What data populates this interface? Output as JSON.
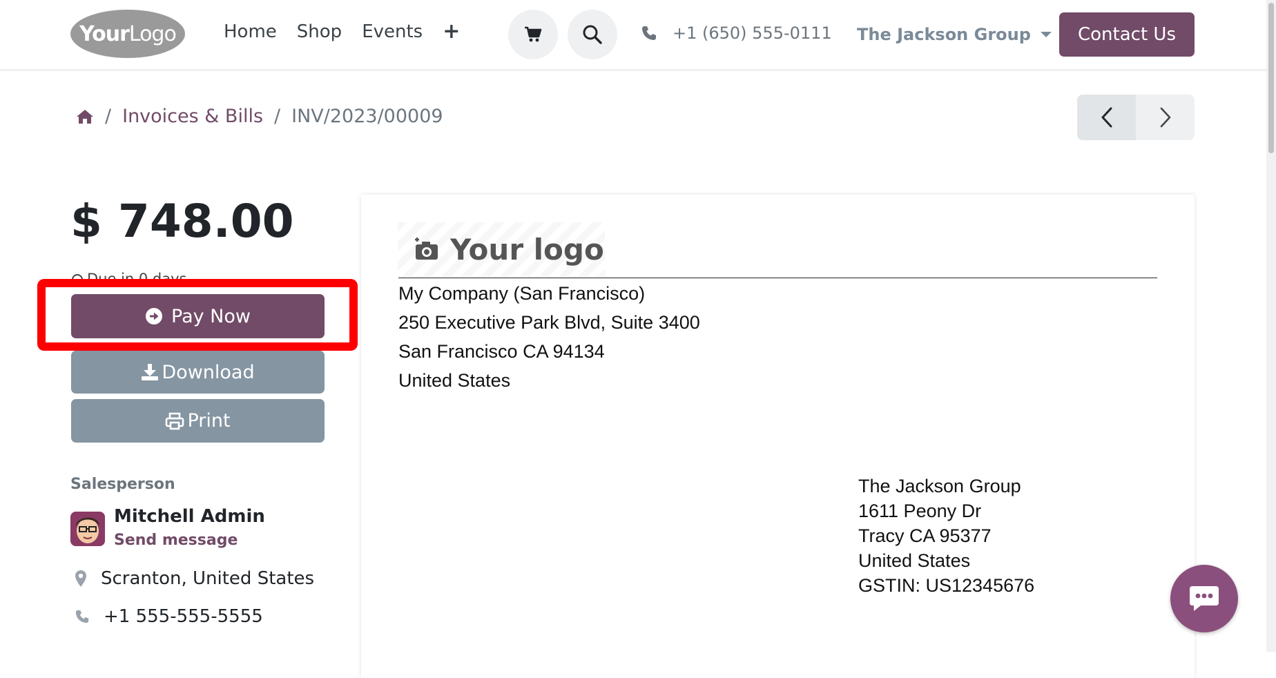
{
  "header": {
    "logo": {
      "bold": "Your",
      "light": "Logo"
    },
    "nav": [
      "Home",
      "Shop",
      "Events"
    ],
    "nav_more": "+",
    "phone": "+1 (650) 555-0111",
    "account": "The Jackson Group",
    "contact_label": "Contact Us"
  },
  "breadcrumb": {
    "sep": "/",
    "section": "Invoices & Bills",
    "current": "INV/2023/00009"
  },
  "summary": {
    "amount": "$ 748.00",
    "due_text": "Due in 0 days",
    "pay_label": "Pay Now",
    "download_label": "Download",
    "print_label": "Print"
  },
  "salesperson": {
    "label": "Salesperson",
    "name": "Mitchell Admin",
    "send": "Send message",
    "location": "Scranton, United States",
    "phone": "+1 555-555-5555"
  },
  "invoice": {
    "logo_text": "Your logo",
    "company_lines": [
      "My Company (San Francisco)",
      "250 Executive Park Blvd, Suite 3400",
      "San Francisco CA 94134",
      "United States"
    ],
    "partner_lines": [
      "The Jackson Group",
      "1611 Peony Dr",
      "Tracy CA 95377",
      "United States",
      "GSTIN: US12345676"
    ]
  },
  "colors": {
    "brand": "#714b67",
    "secondary": "#8595a2",
    "highlight": "#ff0000"
  },
  "icons": [
    "cart-icon",
    "search-icon",
    "phone-icon",
    "home-icon",
    "chevron-left-icon",
    "chevron-right-icon",
    "arrow-circle-right-icon",
    "download-icon",
    "print-icon",
    "map-marker-icon",
    "camera-plus-icon",
    "chat-icon"
  ]
}
